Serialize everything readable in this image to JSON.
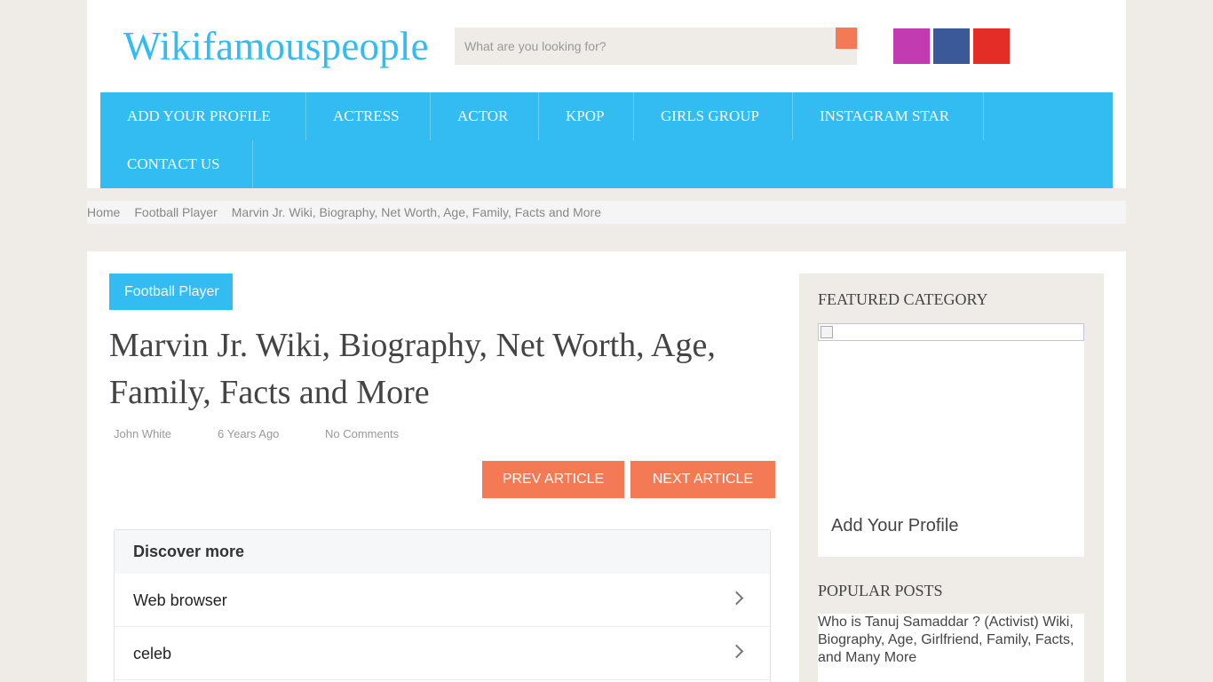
{
  "header": {
    "logo": "Wikifamouspeople",
    "search_placeholder": "What are you looking for?",
    "search_icon": "",
    "social": [
      {
        "name": "instagram",
        "glyph": ""
      },
      {
        "name": "facebook",
        "glyph": ""
      },
      {
        "name": "youtube",
        "glyph": ""
      }
    ]
  },
  "nav": {
    "items": [
      "ADD YOUR PROFILE",
      "ACTRESS",
      "ACTOR",
      "KPOP",
      "GIRLS GROUP",
      "INSTAGRAM STAR",
      "CONTACT US"
    ]
  },
  "breadcrumb": {
    "home": "Home",
    "category": "Football Player",
    "current": "Marvin Jr. Wiki, Biography, Net Worth, Age, Family, Facts and More",
    "separator": ""
  },
  "article": {
    "category_badge": "Football Player",
    "badge_icon": "",
    "title": "Marvin Jr. Wiki, Biography, Net Worth, Age, Family, Facts and More",
    "author": "John White",
    "date": "6 Years Ago",
    "comments": "No Comments",
    "meta_icon": "",
    "prev_label": " PREV ARTICLE",
    "next_label": "NEXT ARTICLE "
  },
  "discover": {
    "heading": "Discover more",
    "items": [
      "Web browser",
      "celeb"
    ]
  },
  "sidebar": {
    "featured_title": "FEATURED CATEGORY",
    "featured_label": "Add Your Profile",
    "popular_title": "POPULAR POSTS",
    "popular_alt": "Who is Tanuj Samaddar ? (Activist) Wiki, Biography, Age, Girlfriend, Family, Facts, and Many More"
  },
  "colors": {
    "accent_blue": "#33bcf2",
    "accent_orange": "#f47a56",
    "background": "#efebe7"
  }
}
